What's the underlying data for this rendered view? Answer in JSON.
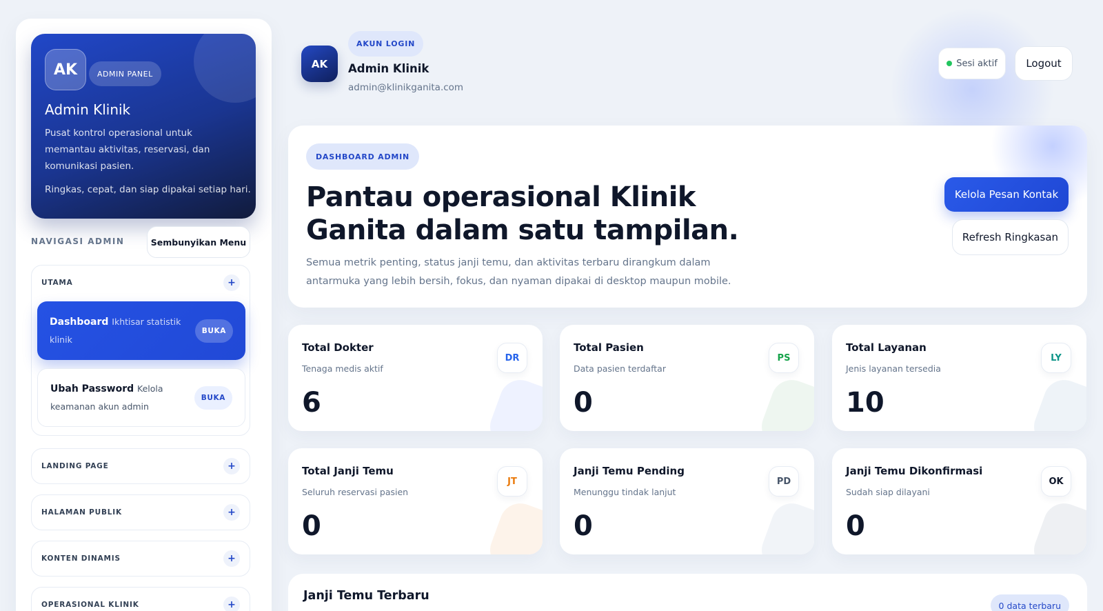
{
  "sidebar": {
    "hero": {
      "initials": "AK",
      "badge": "ADMIN PANEL",
      "title": "Admin Klinik",
      "description": "Pusat kontrol operasional untuk memantau aktivitas, reservasi, dan komunikasi pasien.",
      "tagline": "Ringkas, cepat, dan siap dipakai setiap hari."
    },
    "nav_heading": "NAVIGASI ADMIN",
    "hide_menu_label": "Sembunyikan Menu",
    "groups": [
      {
        "title": "UTAMA",
        "toggle": "+",
        "items": [
          {
            "label": "Dashboard",
            "sub": "Ikhtisar statistik klinik",
            "action": "BUKA"
          },
          {
            "label": "Ubah Password",
            "sub": "Kelola keamanan akun admin",
            "action": "BUKA"
          }
        ]
      },
      {
        "title": "LANDING PAGE",
        "toggle": "+"
      },
      {
        "title": "HALAMAN PUBLIK",
        "toggle": "+"
      },
      {
        "title": "KONTEN DINAMIS",
        "toggle": "+"
      },
      {
        "title": "OPERASIONAL KLINIK",
        "toggle": "+"
      }
    ]
  },
  "header": {
    "initials": "AK",
    "badge": "AKUN LOGIN",
    "name": "Admin Klinik",
    "email": "admin@klinikganita.com",
    "session_status": "Sesi aktif",
    "logout_label": "Logout"
  },
  "banner": {
    "badge": "DASHBOARD ADMIN",
    "title": "Pantau operasional Klinik Ganita dalam satu tampilan.",
    "description": "Semua metrik penting, status janji temu, dan aktivitas terbaru dirangkum dalam antarmuka yang lebih bersih, fokus, dan nyaman dipakai di desktop maupun mobile.",
    "primary_action": "Kelola Pesan Kontak",
    "secondary_action": "Refresh Ringkasan"
  },
  "stats": [
    {
      "title": "Total Dokter",
      "subtitle": "Tenaga medis aktif",
      "value": "6",
      "code": "DR",
      "code_color": "#2563eb",
      "blob_color": "#eef2ff"
    },
    {
      "title": "Total Pasien",
      "subtitle": "Data pasien terdaftar",
      "value": "0",
      "code": "PS",
      "code_color": "#16a34a",
      "blob_color": "#eef6f0"
    },
    {
      "title": "Total Layanan",
      "subtitle": "Jenis layanan tersedia",
      "value": "10",
      "code": "LY",
      "code_color": "#0d9488",
      "blob_color": "#eef3f8"
    },
    {
      "title": "Total Janji Temu",
      "subtitle": "Seluruh reservasi pasien",
      "value": "0",
      "code": "JT",
      "code_color": "#ea7a0c",
      "blob_color": "#fdf3ea"
    },
    {
      "title": "Janji Temu Pending",
      "subtitle": "Menunggu tindak lanjut",
      "value": "0",
      "code": "PD",
      "code_color": "#475569",
      "blob_color": "#f1f4f8"
    },
    {
      "title": "Janji Temu Dikonfirmasi",
      "subtitle": "Sudah siap dilayani",
      "value": "0",
      "code": "OK",
      "code_color": "#0f172a",
      "blob_color": "#eef0f3"
    }
  ],
  "recent": {
    "title": "Janji Temu Terbaru",
    "badge": "0 data terbaru"
  },
  "colors": {
    "accent": "#2552e4",
    "background": "#eef2f8",
    "session_dot": "#22c55e"
  }
}
